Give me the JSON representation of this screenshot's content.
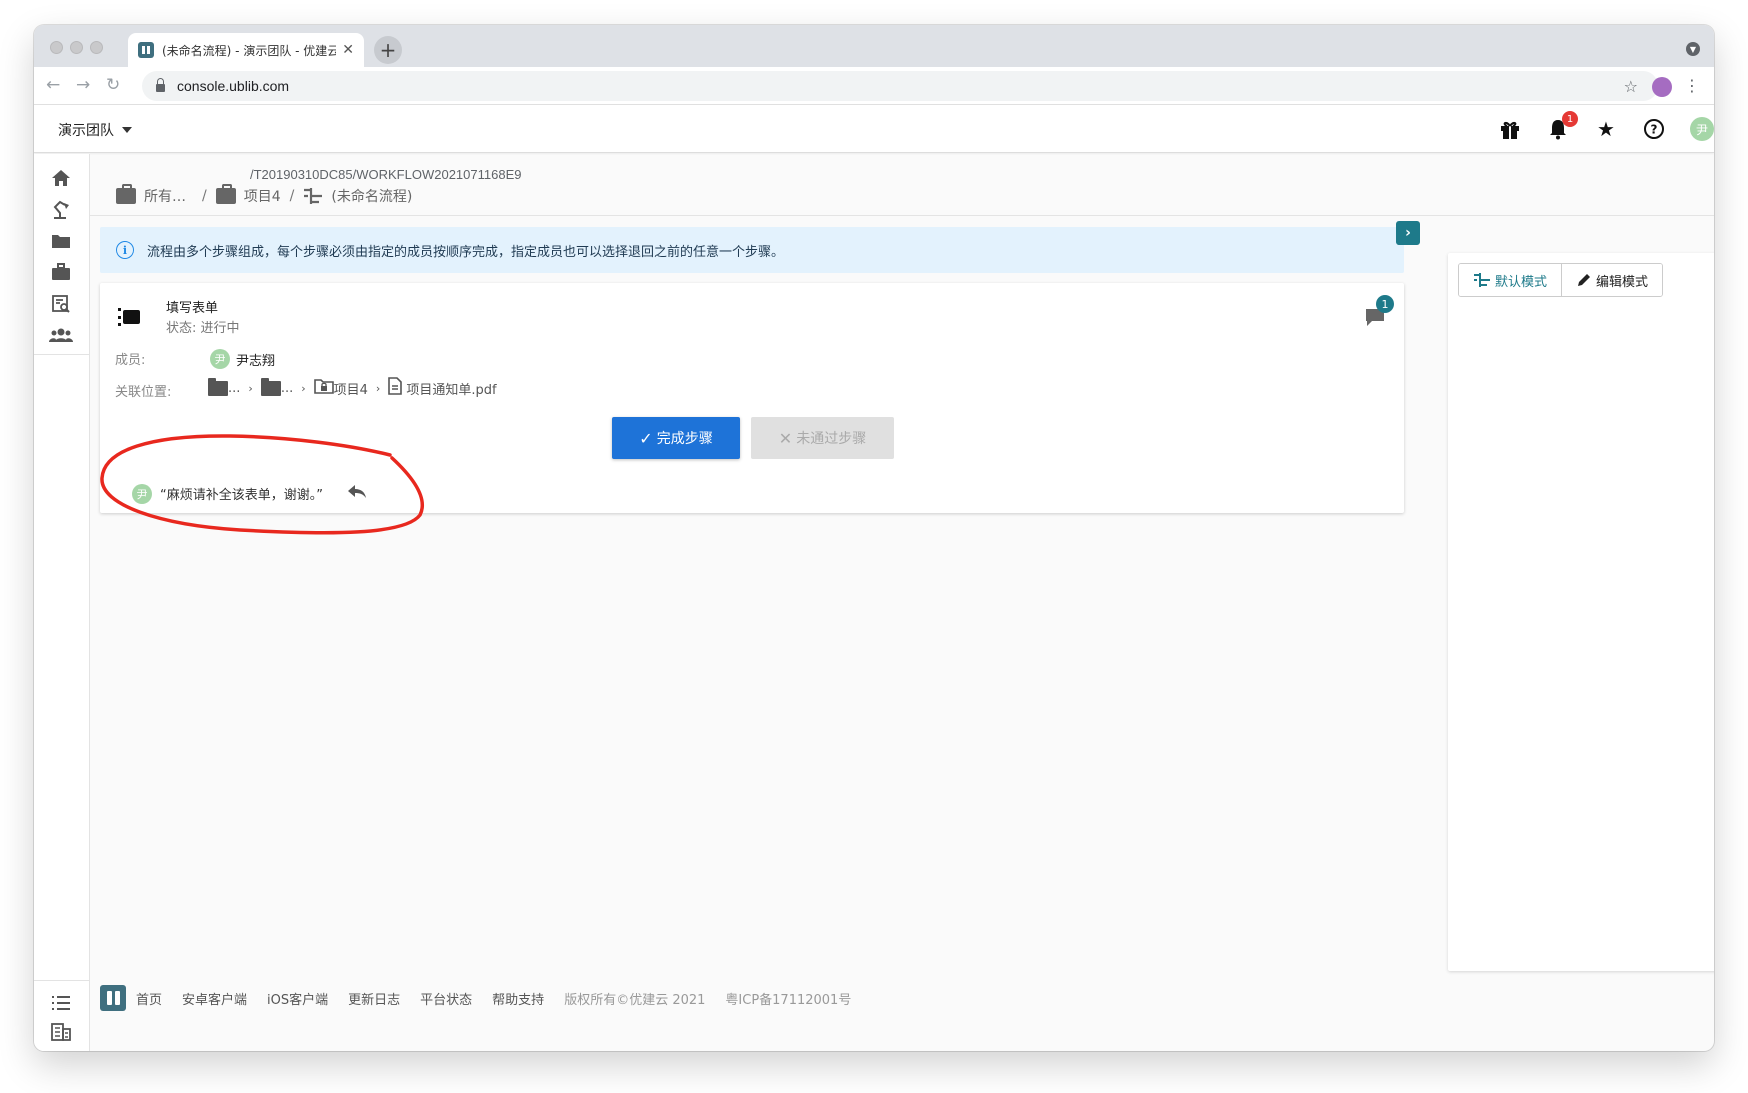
{
  "browser": {
    "tab_title": "(未命名流程) - 演示团队 - 优建云",
    "url_host": "console.ublib.com",
    "url_path": "/T20190310DC85/WORKFLOW2021071168E9"
  },
  "header": {
    "team_name": "演示团队",
    "notification_count": "1",
    "user_initial": "尹"
  },
  "breadcrumb": {
    "items": [
      "所有…",
      "项目4",
      "(未命名流程)"
    ],
    "separator": "/"
  },
  "alert": {
    "text": "流程由多个步骤组成，每个步骤必须由指定的成员按顺序完成，指定成员也可以选择退回之前的任意一个步骤。"
  },
  "step": {
    "title": "填写表单",
    "status": "状态: 进行中",
    "comment_count": "1",
    "member_label": "成员:",
    "member_name": "尹志翔",
    "member_initial": "尹",
    "location_label": "关联位置:",
    "location_items": [
      "...",
      "...",
      "项目4",
      "项目通知单.pdf"
    ],
    "complete_button": "完成步骤",
    "reject_button": "未通过步骤",
    "comment_text": "“麻烦请补全该表单，谢谢。”",
    "comment_initial": "尹"
  },
  "modes": {
    "default_label": "默认模式",
    "edit_label": "编辑模式"
  },
  "footer": {
    "links": [
      "首页",
      "安卓客户端",
      "iOS客户端",
      "更新日志",
      "平台状态",
      "帮助支持"
    ],
    "copyright": "版权所有©优建云 2021",
    "icp": "粤ICP备17112001号"
  },
  "colors": {
    "primary": "#1e73d8",
    "teal": "#1e7a8a",
    "alert_bg": "#e3f2fd",
    "annotation_red": "#e8281e"
  }
}
